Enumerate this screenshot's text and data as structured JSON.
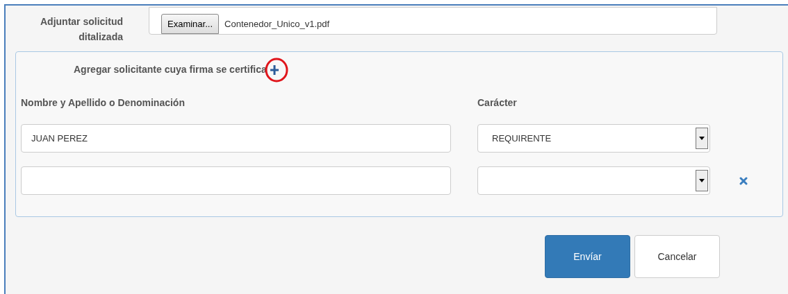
{
  "attachment": {
    "label": "Adjuntar solicitud ditalizada",
    "browse_button": "Examinar...",
    "file_name": "Contenedor_Unico_v1.pdf"
  },
  "applicants": {
    "heading": "Agregar solicitante cuya firma se certifica",
    "add_highlighted": true,
    "columns": [
      "Nombre y Apellido o Denominación",
      "Carácter"
    ],
    "rows": [
      {
        "name": "JUAN PEREZ",
        "character": "REQUIRENTE",
        "removable": false
      },
      {
        "removable": true
      }
    ]
  },
  "buttons": [
    {
      "label": "Envíar",
      "kind": "primary"
    },
    {
      "label": "Cancelar",
      "kind": "default"
    }
  ]
}
